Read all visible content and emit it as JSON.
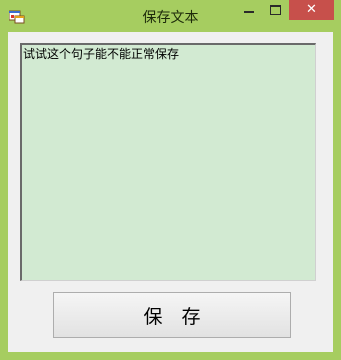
{
  "window": {
    "title": "保存文本",
    "app_icon": "winforms-app-icon",
    "controls": {
      "minimize_icon": "minimize-icon",
      "maximize_icon": "maximize-icon",
      "close_label": "✕"
    },
    "accent_color": "#a6cd60",
    "close_color": "#c7504b"
  },
  "editor": {
    "value": "试试这个句子能不能正常保存",
    "background_color": "#d2ead2"
  },
  "actions": {
    "save_label": "保　存"
  }
}
